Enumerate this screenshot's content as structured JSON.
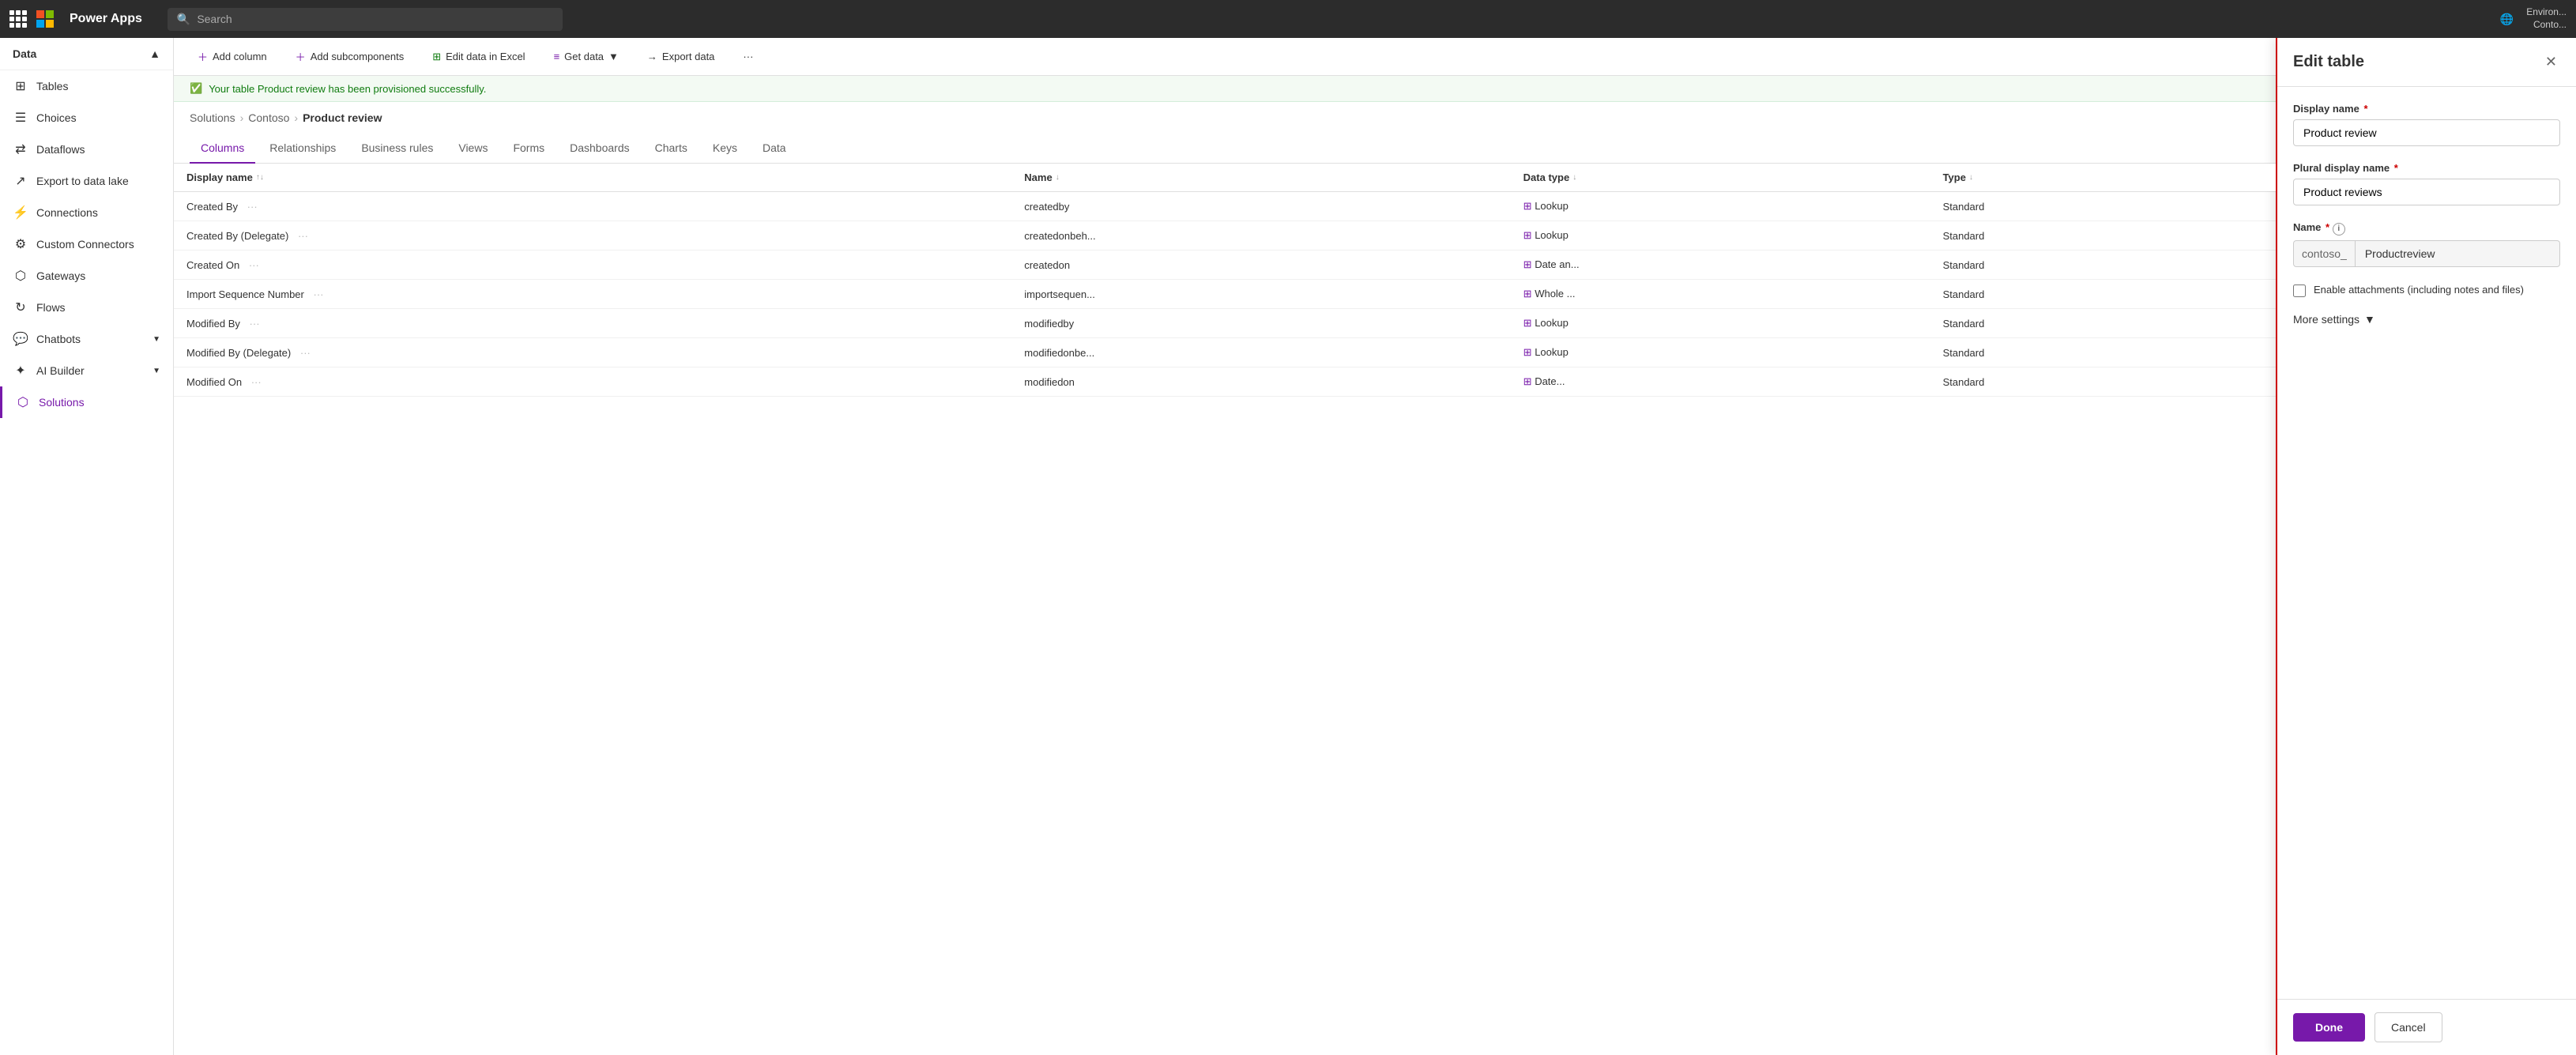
{
  "topnav": {
    "app_name": "Power Apps",
    "search_placeholder": "Search",
    "env_label": "Environ...",
    "env_sub": "Conto..."
  },
  "sidebar": {
    "section": "Data",
    "items": [
      {
        "id": "tables",
        "label": "Tables",
        "icon": ""
      },
      {
        "id": "choices",
        "label": "Choices",
        "icon": ""
      },
      {
        "id": "dataflows",
        "label": "Dataflows",
        "icon": ""
      },
      {
        "id": "export",
        "label": "Export to data lake",
        "icon": ""
      },
      {
        "id": "connections",
        "label": "Connections",
        "icon": ""
      },
      {
        "id": "custom-connectors",
        "label": "Custom Connectors",
        "icon": ""
      },
      {
        "id": "gateways",
        "label": "Gateways",
        "icon": ""
      },
      {
        "id": "flows",
        "label": "Flows",
        "icon": "↻"
      },
      {
        "id": "chatbots",
        "label": "Chatbots",
        "icon": "💬"
      },
      {
        "id": "ai-builder",
        "label": "AI Builder",
        "icon": "⚙"
      },
      {
        "id": "solutions",
        "label": "Solutions",
        "icon": ""
      }
    ]
  },
  "toolbar": {
    "add_column": "Add column",
    "add_subcomponents": "Add subcomponents",
    "edit_excel": "Edit data in Excel",
    "get_data": "Get data",
    "export_data": "Export data"
  },
  "success_banner": "Your table Product review has been provisioned successfully.",
  "breadcrumb": {
    "solutions": "Solutions",
    "contoso": "Contoso",
    "current": "Product review"
  },
  "tabs": [
    {
      "id": "columns",
      "label": "Columns",
      "active": true
    },
    {
      "id": "relationships",
      "label": "Relationships"
    },
    {
      "id": "business-rules",
      "label": "Business rules"
    },
    {
      "id": "views",
      "label": "Views"
    },
    {
      "id": "forms",
      "label": "Forms"
    },
    {
      "id": "dashboards",
      "label": "Dashboards"
    },
    {
      "id": "charts",
      "label": "Charts"
    },
    {
      "id": "keys",
      "label": "Keys"
    },
    {
      "id": "data",
      "label": "Data"
    }
  ],
  "table_columns": {
    "headers": [
      {
        "id": "display-name",
        "label": "Display name",
        "sortable": true
      },
      {
        "id": "name",
        "label": "Name",
        "sortable": true
      },
      {
        "id": "data-type",
        "label": "Data type",
        "sortable": true
      },
      {
        "id": "type",
        "label": "Type",
        "sortable": true
      }
    ],
    "rows": [
      {
        "display_name": "Created By",
        "name": "createdby",
        "data_type": "Lookup",
        "type": "Standard"
      },
      {
        "display_name": "Created By (Delegate)",
        "name": "createdonbeh...",
        "data_type": "Lookup",
        "type": "Standard"
      },
      {
        "display_name": "Created On",
        "name": "createdon",
        "data_type": "Date an...",
        "type": "Standard"
      },
      {
        "display_name": "Import Sequence Number",
        "name": "importsequen...",
        "data_type": "Whole ...",
        "type": "Standard"
      },
      {
        "display_name": "Modified By",
        "name": "modifiedby",
        "data_type": "Lookup",
        "type": "Standard"
      },
      {
        "display_name": "Modified By (Delegate)",
        "name": "modifiedonbe...",
        "data_type": "Lookup",
        "type": "Standard"
      },
      {
        "display_name": "Modified On",
        "name": "modifiedon",
        "data_type": "Date...",
        "type": "Standard"
      }
    ]
  },
  "edit_panel": {
    "title": "Edit table",
    "display_name_label": "Display name",
    "display_name_value": "Product review",
    "plural_name_label": "Plural display name",
    "plural_name_value": "Product reviews",
    "name_label": "Name",
    "name_prefix": "contoso_",
    "name_value": "Productreview",
    "attachments_label": "Enable attachments (including notes and files)",
    "more_settings": "More settings",
    "done_btn": "Done",
    "cancel_btn": "Cancel"
  }
}
